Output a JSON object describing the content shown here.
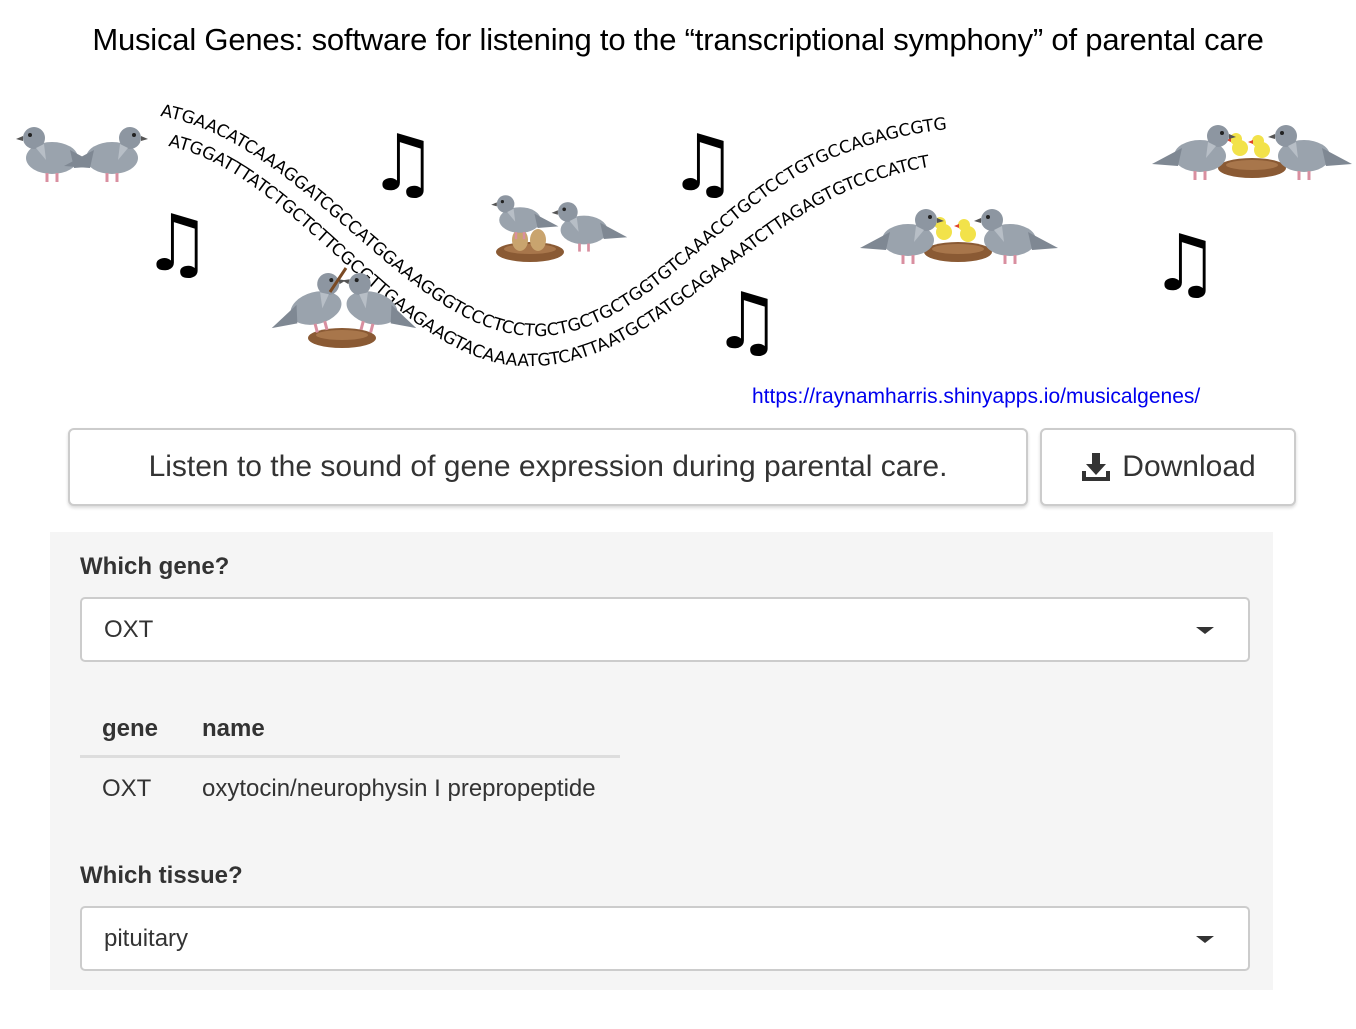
{
  "title": "Musical Genes: software for listening to the “transcriptional symphony” of parental care",
  "banner": {
    "dna_top": "ATGAACATCAAAGGATCGCCATGGAAAGGGTCCCTCCTGCTGCTGCTGGTGTCAAACCTGCTCCTGTGCCAGAGCGTG",
    "dna_bottom": "ATGGATTTATCTGCTCTTCGCGTTGAAGAAGTACAAAATGTCATTAATGCTATGCAGAAAATCTTAGAGTGTCCCATCT",
    "note_glyph": "♫",
    "icons": [
      "pigeon-pair-icon",
      "pigeons-building-nest-icon",
      "pigeons-with-eggs-icon",
      "pigeons-with-hatchlings-icon",
      "pigeons-with-chicks-icon",
      "music-note-icon"
    ]
  },
  "url": "https://raynamharris.shinyapps.io/musicalgenes/",
  "buttons": {
    "listen_label": "Listen to the sound of gene expression during parental care.",
    "download_label": "Download",
    "download_icon": "download-icon"
  },
  "panel": {
    "gene_label": "Which gene?",
    "gene_selected": "OXT",
    "table": {
      "headers": [
        "gene",
        "name"
      ],
      "rows": [
        [
          "OXT",
          "oxytocin/neurophysin I prepropeptide"
        ]
      ]
    },
    "tissue_label": "Which tissue?",
    "tissue_selected": "pituitary"
  },
  "colors": {
    "link": "#0000ee",
    "panel_bg": "#f5f5f5",
    "pigeon": "#9aa3ad",
    "nest": "#8a5a34",
    "chick": "#f2e24a"
  }
}
